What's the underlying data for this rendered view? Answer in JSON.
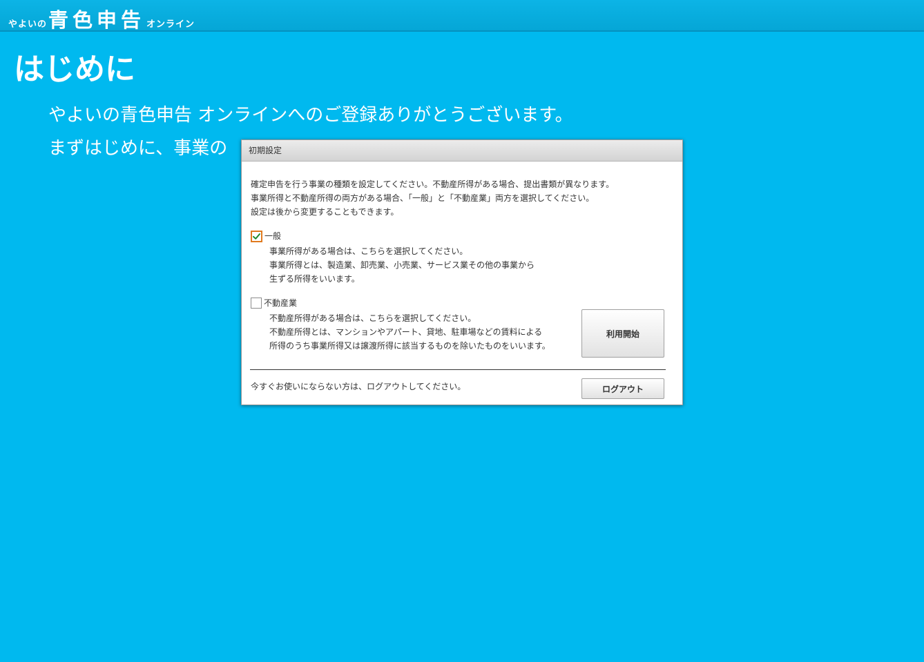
{
  "header": {
    "logo_prefix": "やよいの",
    "logo_main": "青色申告",
    "logo_suffix": "オンライン"
  },
  "page": {
    "title": "はじめに",
    "intro_line1": "やよいの青色申告 オンラインへのご登録ありがとうございます。",
    "intro_line2": "まずはじめに、事業の"
  },
  "dialog": {
    "title": "初期設定",
    "description": [
      "確定申告を行う事業の種類を設定してください。不動産所得がある場合、提出書類が異なります。",
      "事業所得と不動産所得の両方がある場合、「一般」と「不動産業」両方を選択してください。",
      "設定は後から変更することもできます。"
    ],
    "options": [
      {
        "label": "一般",
        "checked": true,
        "description": [
          "事業所得がある場合は、こちらを選択してください。",
          "事業所得とは、製造業、卸売業、小売業、サービス業その他の事業から",
          "生ずる所得をいいます。"
        ]
      },
      {
        "label": "不動産業",
        "checked": false,
        "description": [
          "不動産所得がある場合は、こちらを選択してください。",
          "不動産所得とは、マンションやアパート、貸地、駐車場などの賃料による",
          "所得のうち事業所得又は譲渡所得に該当するものを除いたものをいいます。"
        ]
      }
    ],
    "start_button": "利用開始",
    "logout_text": "今すぐお使いにならない方は、ログアウトしてください。",
    "logout_button": "ログアウト"
  },
  "colors": {
    "background": "#00b9ef",
    "checkbox_focus": "#e07a1f",
    "checkmark": "#1e8a2e"
  }
}
